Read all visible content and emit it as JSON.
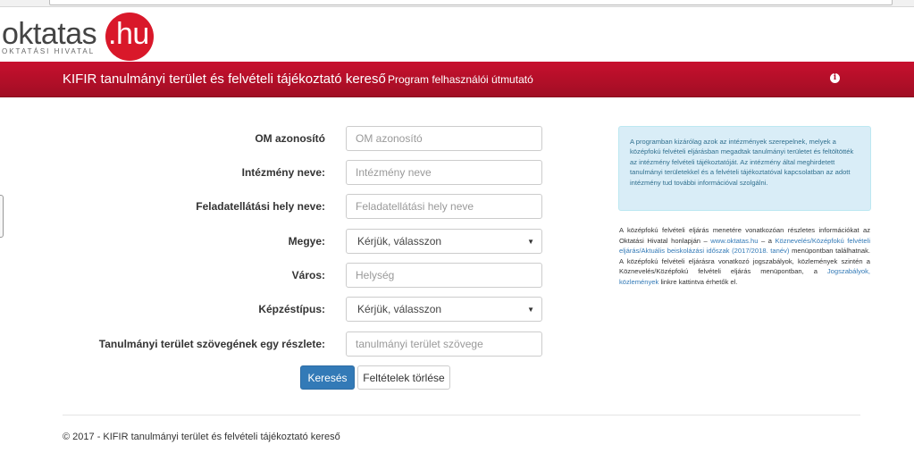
{
  "logo": {
    "word": "oktatas",
    "domain": ".hu",
    "subtitle": "OKTATÁSI HIVATAL"
  },
  "navbar": {
    "brand": "KIFIR tanulmányi terület és felvételi tájékoztató kereső",
    "guide": "Program felhasználói útmutató",
    "info_icon": "info-icon"
  },
  "form": {
    "om": {
      "label": "OM azonosító",
      "placeholder": "OM azonosító"
    },
    "institution": {
      "label": "Intézmény neve:",
      "placeholder": "Intézmény neve"
    },
    "site": {
      "label": "Feladatellátási hely neve:",
      "placeholder": "Feladatellátási hely neve"
    },
    "county": {
      "label": "Megye:",
      "value": "Kérjük, válasszon"
    },
    "city": {
      "label": "Város:",
      "placeholder": "Helység"
    },
    "training": {
      "label": "Képzéstípus:",
      "value": "Kérjük, válasszon"
    },
    "text": {
      "label": "Tanulmányi terület szövegének egy részlete:",
      "placeholder": "tanulmányi terület szövege"
    }
  },
  "buttons": {
    "search": "Keresés",
    "clear": "Feltételek törlése"
  },
  "alert": {
    "text": "A programban kizárólag azok az intézmények szerepelnek, melyek a középfokú felvételi eljárásban megadtak tanulmányi területet és feltöltötték az intézmény felvételi tájékoztatóját. Az intézmény által meghirdetett tanulmányi területekkel és a felvételi tájékoztatóval kapcsolatban az adott intézmény tud további információval szolgálni."
  },
  "notice": {
    "part1": "A középfokú felvételi eljárás menetére vonatkozóan részletes információkat az Oktatási Hivatal honlapján – ",
    "link1": "www.oktatas.hu",
    "part2": " – a ",
    "link2": "Köznevelés/Középfokú felvételi eljárás/Aktuális beiskolázási időszak (2017/2018. tanév)",
    "part3": " menüpontban találhatnak. A középfokú felvételi eljárásra vonatkozó jogszabályok, közlemények szintén a Köznevelés/Középfokú felvételi eljárás menüpontban, a ",
    "link3": "Jogszabályok, közlemények",
    "part4": " linkre kattintva érhetők el."
  },
  "footer": {
    "text": "© 2017 - KIFIR tanulmányi terület és felvételi tájékoztató kereső"
  },
  "colors": {
    "navbar": "#c8102e",
    "primary_button": "#337ab7",
    "alert_bg": "#d9edf7",
    "alert_text": "#31708f",
    "logo_circle": "#d9182a"
  }
}
